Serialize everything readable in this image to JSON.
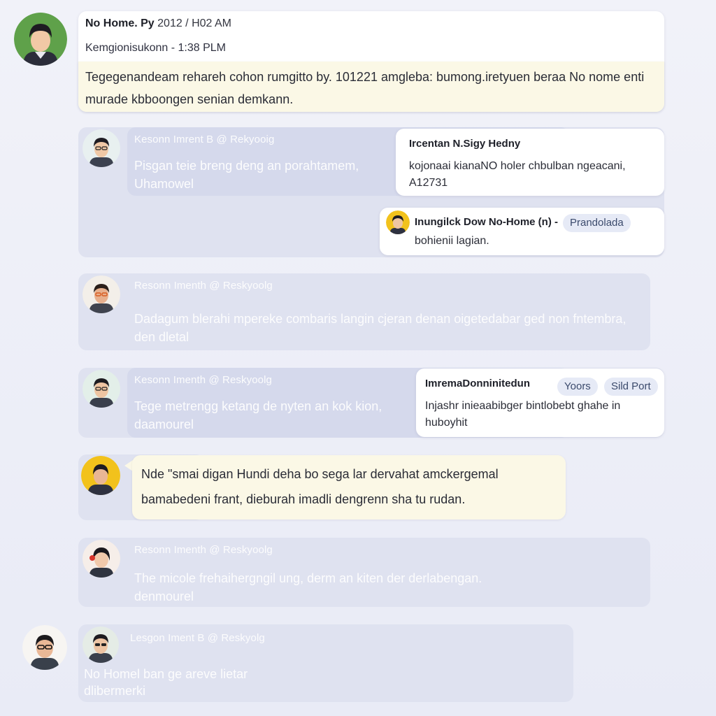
{
  "post": {
    "author": "No Home. Py",
    "time": "2012 / H02 AM",
    "subtitle": "Kemgionisukonn - 1:38 PLM",
    "body": "Tegegenandeam rehareh cohon rumgitto by. 101221 amgleba: bumong.iretyuen beraa No nome enti murade kbboongen senian demkann."
  },
  "replies": [
    {
      "meta": "Kesonn Imrent B @ Rekyooig",
      "text": "Pisgan teie breng deng an porahtamem, Uhamowel"
    },
    {
      "meta": "Resonn Imenth @ Reskyoolg",
      "text": "Dadagum blerahi mpereke combaris langin cjeran denan oigetedabar ged non fntembra, den dletal"
    },
    {
      "meta": "Kesonn Imenth @ Reskyoolg",
      "text": "Tege metrengg ketang de nyten an kok kion, daamourel"
    },
    {
      "meta": "Resonn Imenth @ Reskyoolg",
      "text": "The micole frehaihergngil ung, derm an kiten der derlabengan. denmourel"
    },
    {
      "meta": "Lesgon Iment B @ Reskyolg",
      "text": "No Homel ban ge areve lietar dlibermerki"
    }
  ],
  "popups": [
    {
      "title": "Ircentan N.Sigy Hedny",
      "body": "kojonaai kianaNO holer chbulban ngeacani, A12731"
    },
    {
      "title": "Inungilck Dow No-Home (n) -",
      "tag": "Prandolada",
      "body": "bohienii lagian."
    },
    {
      "title": "ImremaDonninitedun",
      "tags": [
        "Yoors",
        "Sild Port"
      ],
      "body": "Injashr inieaabibger bintlobebt ghahe in huboyhit"
    }
  ],
  "highlight_reply": {
    "text": "Nde \"smai digan Hundi deha bo sega lar dervahat amckergemal bamabedeni frant, dieburah imadli dengrenn sha tu rudan."
  },
  "avatars": {
    "main": "avatar-green-bg",
    "reply1": "avatar-glasses",
    "reply2": "avatar-glasses-orange",
    "reply3": "avatar-glasses-green",
    "highlight": "avatar-yellow-bg",
    "reply4": "avatar-red-flower",
    "bottom_left": "avatar-glasses-dark",
    "popup2": "avatar-yellow-small"
  },
  "colors": {
    "background": "#eef0f8",
    "card": "#ffffff",
    "faded_card": "#dfe2f0",
    "note_yellow": "#fbf8e6",
    "tag_bg": "#e6eaf6"
  }
}
